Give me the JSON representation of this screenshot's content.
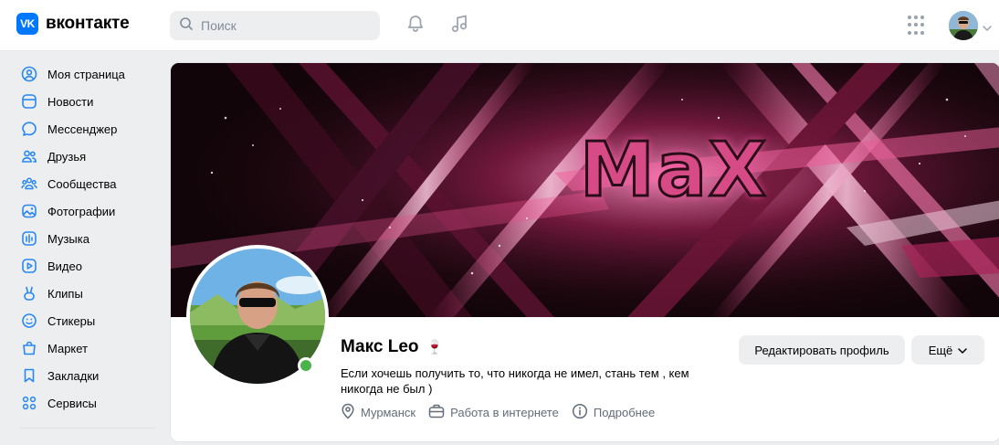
{
  "header": {
    "logo_text": "вконтакте",
    "logo_mark": "VK",
    "search_placeholder": "Поиск",
    "icons": [
      "bell-icon",
      "music-icon",
      "apps-grid-icon"
    ]
  },
  "sidebar": {
    "items": [
      {
        "label": "Моя страница",
        "icon": "user-circle-icon"
      },
      {
        "label": "Новости",
        "icon": "news-icon"
      },
      {
        "label": "Мессенджер",
        "icon": "message-icon"
      },
      {
        "label": "Друзья",
        "icon": "friends-icon"
      },
      {
        "label": "Сообщества",
        "icon": "communities-icon"
      },
      {
        "label": "Фотографии",
        "icon": "photo-icon"
      },
      {
        "label": "Музыка",
        "icon": "music-icon"
      },
      {
        "label": "Видео",
        "icon": "video-icon"
      },
      {
        "label": "Клипы",
        "icon": "clips-icon"
      },
      {
        "label": "Стикеры",
        "icon": "sticker-icon"
      },
      {
        "label": "Маркет",
        "icon": "market-icon"
      },
      {
        "label": "Закладки",
        "icon": "bookmark-icon"
      },
      {
        "label": "Сервисы",
        "icon": "services-icon"
      }
    ]
  },
  "profile": {
    "cover_text": "MaX",
    "name": "Макс Leo",
    "name_emoji": "🍷",
    "status": "Если хочешь получить то, что никогда не имел, стань тем , кем никогда не был )",
    "city": "Мурманск",
    "job": "Работа в интернете",
    "details_label": "Подробнее",
    "edit_button": "Редактировать профиль",
    "more_button": "Ещё",
    "online": true
  },
  "colors": {
    "accent": "#2787f5",
    "brand": "#0077ff",
    "online": "#4bb34b",
    "cover_pink": "#d64b86"
  }
}
